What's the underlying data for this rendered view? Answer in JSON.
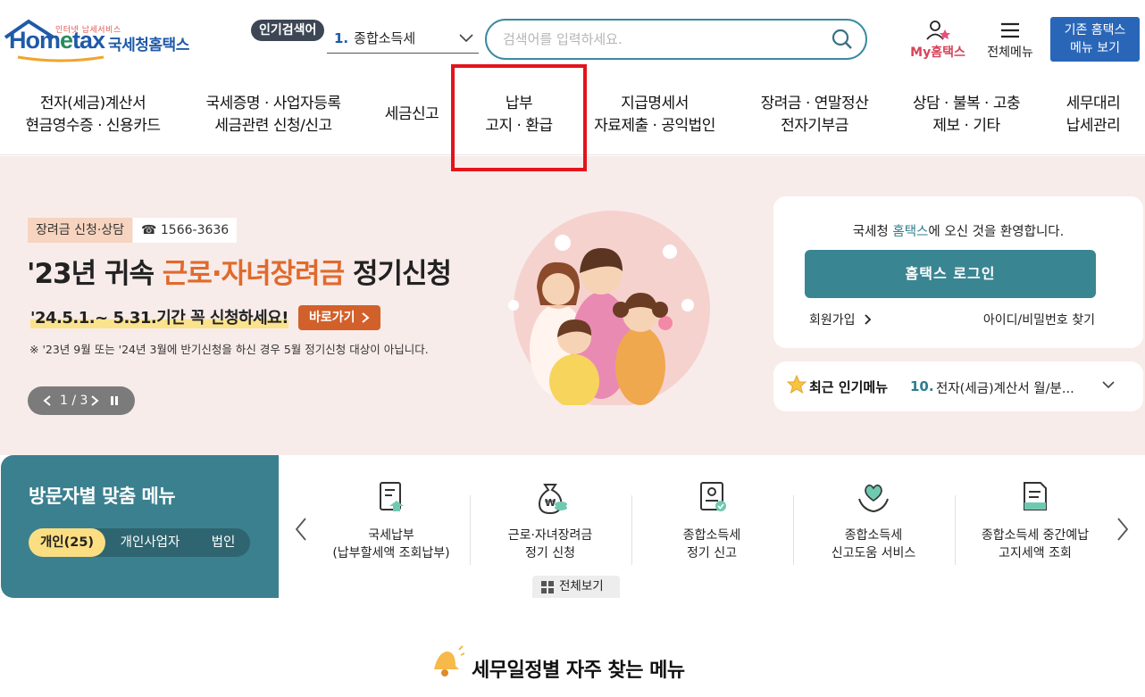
{
  "header": {
    "logo_small": "인터넷 납세서비스",
    "logo_brand_a": "Hom",
    "logo_brand_e": "e",
    "logo_brand_b": "tax",
    "logo_kor": "국세청홈택스",
    "popular_label": "인기검색어",
    "popular_rank": "1.",
    "popular_term": "종합소득세",
    "search_placeholder": "검색어를 입력하세요.",
    "my_hometax": "My홈택스",
    "all_menu": "전체메뉴",
    "legacy_line1": "기존 홈택스",
    "legacy_line2": "메뉴 보기"
  },
  "gnb": {
    "items": [
      {
        "line1": "전자(세금)계산서",
        "line2": "현금영수증 · 신용카드"
      },
      {
        "line1": "국세증명 · 사업자등록",
        "line2": "세금관련 신청/신고"
      },
      {
        "line1": "세금신고",
        "line2": ""
      },
      {
        "line1": "납부",
        "line2": "고지 · 환급"
      },
      {
        "line1": "지급명세서",
        "line2": "자료제출 · 공익법인"
      },
      {
        "line1": "장려금 · 연말정산",
        "line2": "전자기부금"
      },
      {
        "line1": "상담 · 불복 · 고충",
        "line2": "제보 · 기타"
      },
      {
        "line1": "세무대리",
        "line2": "납세관리"
      }
    ]
  },
  "hero": {
    "tag": "장려금 신청·상담",
    "phone": "☎ 1566-3636",
    "title_pre": "'23년 귀속 ",
    "title_accent": "근로·자녀장려금",
    "title_post": " 정기신청",
    "period": "'24.5.1.~ 5.31.기간 꼭 신청하세요!",
    "go_button": "바로가기",
    "note": "※ '23년 9월 또는 '24년 3월에 반기신청을 하신 경우 5월 정기신청 대상이 아닙니다.",
    "pager": "1 / 3"
  },
  "login": {
    "welcome_pre": "국세청 ",
    "welcome_hl": "홈택스",
    "welcome_post": "에 오신 것을 환영합니다.",
    "login_button": "홈택스 로그인",
    "join": "회원가입",
    "find": "아이디/비밀번호 찾기"
  },
  "recent": {
    "title": "최근 인기메뉴",
    "rank": "10.",
    "item": "전자(세금)계산서 월/분..."
  },
  "visitor": {
    "title": "방문자별 맞춤 메뉴",
    "tabs": [
      "개인(25)",
      "개인사업자",
      "법인"
    ],
    "items": [
      {
        "line1": "국세납부",
        "line2": "(납부할세액 조회납부)",
        "icon": "tax-payment-icon"
      },
      {
        "line1": "근로·자녀장려금",
        "line2": "정기 신청",
        "icon": "money-bag-icon"
      },
      {
        "line1": "종합소득세",
        "line2": "정기 신고",
        "icon": "tax-report-icon"
      },
      {
        "line1": "종합소득세",
        "line2": "신고도움 서비스",
        "icon": "helping-heart-icon"
      },
      {
        "line1": "종합소득세 중간예납",
        "line2": "고지세액 조회",
        "icon": "notice-doc-icon"
      }
    ],
    "view_all": "전체보기"
  },
  "schedule": {
    "title": "세무일정별 자주 찾는 메뉴"
  }
}
